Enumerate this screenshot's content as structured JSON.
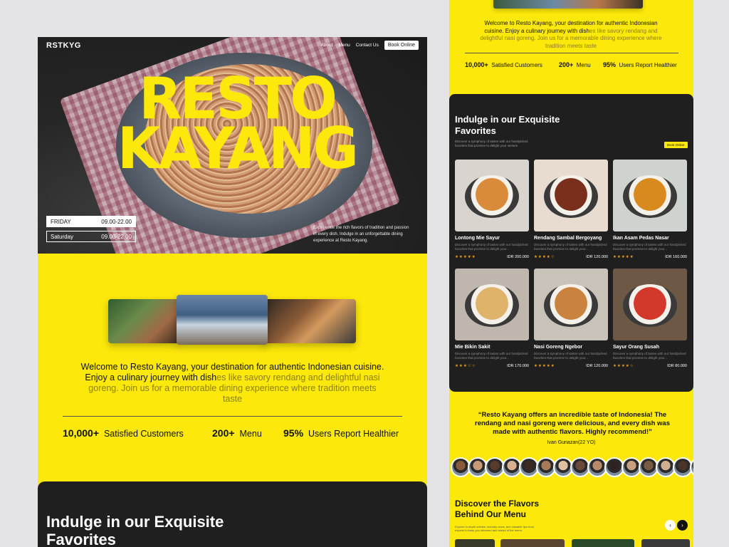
{
  "brand": "RSTKYG",
  "nav": {
    "about": "About",
    "menu": "Menu",
    "contact": "Contact Us",
    "book": "Book Online"
  },
  "hero": {
    "title_line1": "RESTO",
    "title_line2": "KAYANG",
    "hours": [
      {
        "day": "FRIDAY",
        "time": "09.00-22.00"
      },
      {
        "day": "Saturday",
        "time": "09.00-22.00"
      }
    ],
    "description": "Experience the rich flavors of tradition and passion in every dish. Indulge in an unforgettable dining experience at Resto Kayang."
  },
  "welcome": {
    "part1": "Welcome to Resto Kayang, your destination for authentic Indonesian cuisine. Enjoy a culinary journey with dish",
    "part2": "es like savory rendang and delightful nasi goreng. Join us for a memorable dining experience where tradition meets taste"
  },
  "stats": [
    {
      "value": "10,000+",
      "label": "Satisfied Customers"
    },
    {
      "value": "200+",
      "label": "Menu"
    },
    {
      "value": "95%",
      "label": "Users Report Healthier"
    }
  ],
  "favorites": {
    "title": "Indulge in our Exquisite Favorites",
    "subtitle": "Discover a symphony of tastes with our handpicked favorites that promise to delight your senses",
    "book": "Book Online"
  },
  "menu_items": [
    {
      "name": "Lontong Mie Sayur",
      "desc": "Discover a symphony of tastes with our handpicked favorites that promise to delight your...",
      "stars": "★★★★★",
      "price": "IDR 200.000",
      "color": "#d98a3a"
    },
    {
      "name": "Rendang Sambal Bergoyang",
      "desc": "Discover a symphony of tastes with our handpicked favorites that promise to delight your...",
      "stars": "★★★★☆",
      "price": "IDR 120.000",
      "color": "#7a2e1c"
    },
    {
      "name": "Ikan Asam Pedas Nasar",
      "desc": "Discover a symphony of tastes with our handpicked favorites that promise to delight your...",
      "stars": "★★★★★",
      "price": "IDR 160.000",
      "color": "#d98a1e"
    },
    {
      "name": "Mie Bikin Sakit",
      "desc": "Discover a symphony of tastes with our handpicked favorites that promise to delight your...",
      "stars": "★★★☆☆",
      "price": "IDR 170.000",
      "color": "#e0b36a"
    },
    {
      "name": "Nasi Goreng Ngebor",
      "desc": "Discover a symphony of tastes with our handpicked favorites that promise to delight your...",
      "stars": "★★★★★",
      "price": "IDR 120.000",
      "color": "#c9833e"
    },
    {
      "name": "Sayur Orang Susah",
      "desc": "Discover a symphony of tastes with our handpicked favorites that promise to delight your...",
      "stars": "★★★★☆",
      "price": "IDR 80.000",
      "color": "#d4382a"
    }
  ],
  "testimonial": {
    "quote": "“Resto Kayang offers an incredible taste of Indonesia! The rendang and nasi goreng were delicious, and every dish was made with authentic flavors. Highly recommend!”",
    "author": "Ivan Gunazan(22 YO)"
  },
  "discover": {
    "title": "Discover the Flavors Behind Our Menu",
    "subtitle": "Explore in-depth articles, industry news, and valuable tips from experts to keep you informed and ahead of the menu.",
    "prev": "‹",
    "next": "›"
  },
  "colors": {
    "accent": "#fce80a",
    "dark": "#1f1f1f",
    "star": "#f5a21b"
  }
}
